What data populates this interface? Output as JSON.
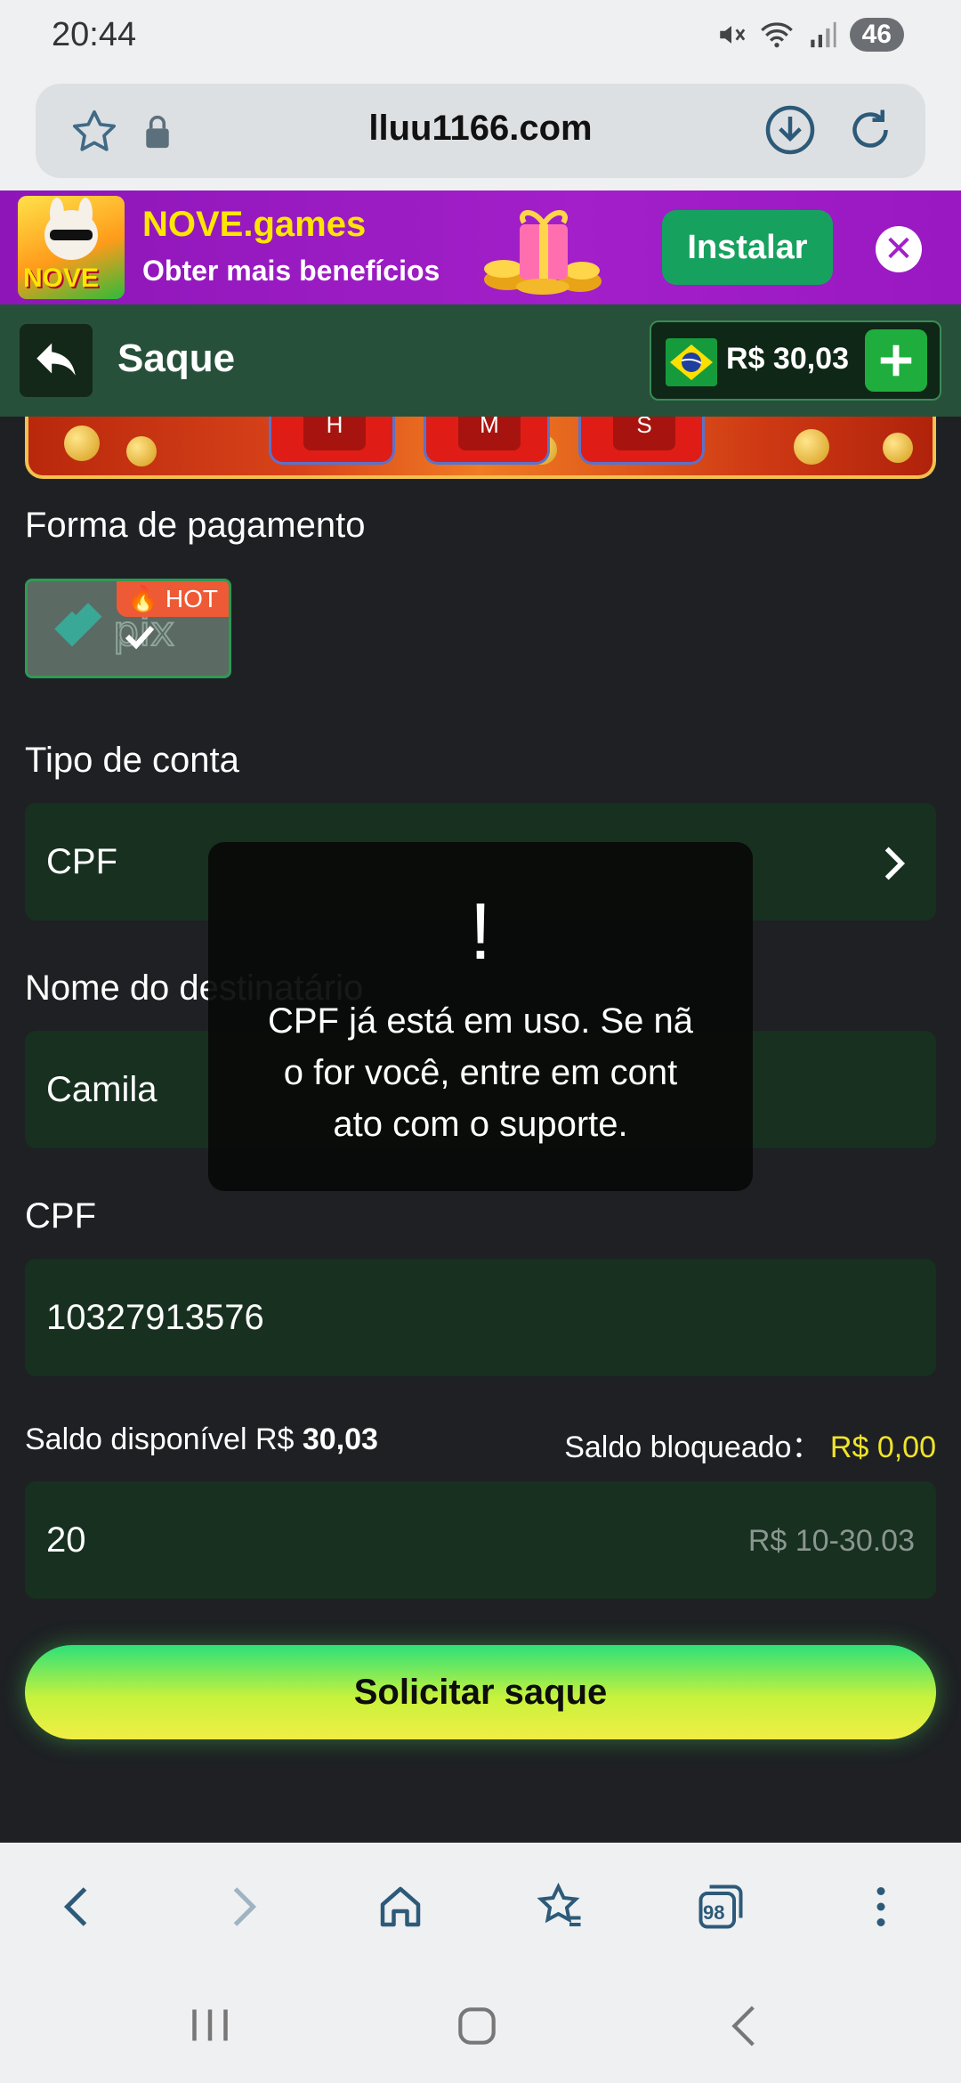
{
  "status_bar": {
    "time": "20:44",
    "battery": "46"
  },
  "browser": {
    "url": "lluu1166.com",
    "tabs_count": "98"
  },
  "promo": {
    "logo_text": "NOVE",
    "title": "NOVE.games",
    "subtitle": "Obter mais benefícios",
    "install_label": "Instalar",
    "close_symbol": "✕"
  },
  "header": {
    "title": "Saque",
    "balance": "R$ 30,03"
  },
  "hero": {
    "timer_labels": [
      "H",
      "M",
      "S"
    ]
  },
  "form": {
    "payment_label": "Forma de pagamento",
    "payment_method": "pix",
    "payment_badge": "HOT",
    "account_type_label": "Tipo de conta",
    "account_type_value": "CPF",
    "recipient_label": "Nome do destinatário",
    "recipient_value": "Camila",
    "cpf_label": "CPF",
    "cpf_value": "10327913576",
    "available_prefix": "Saldo disponível R$",
    "available_amount": "30,03",
    "blocked_label": "Saldo bloqueado：",
    "blocked_amount": "R$ 0,00",
    "amount_value": "20",
    "amount_hint": "R$ 10-30.03",
    "submit_label": "Solicitar saque"
  },
  "toast": {
    "mark": "!",
    "line1": "CPF já está em uso. Se nã",
    "line2": "o for você, entre em cont",
    "line3": "ato com o suporte."
  },
  "colors": {
    "header_bg": "#27503a",
    "field_bg": "#17301f",
    "accent_green": "#1fae3d",
    "blocked_yellow": "#f0e42a"
  }
}
